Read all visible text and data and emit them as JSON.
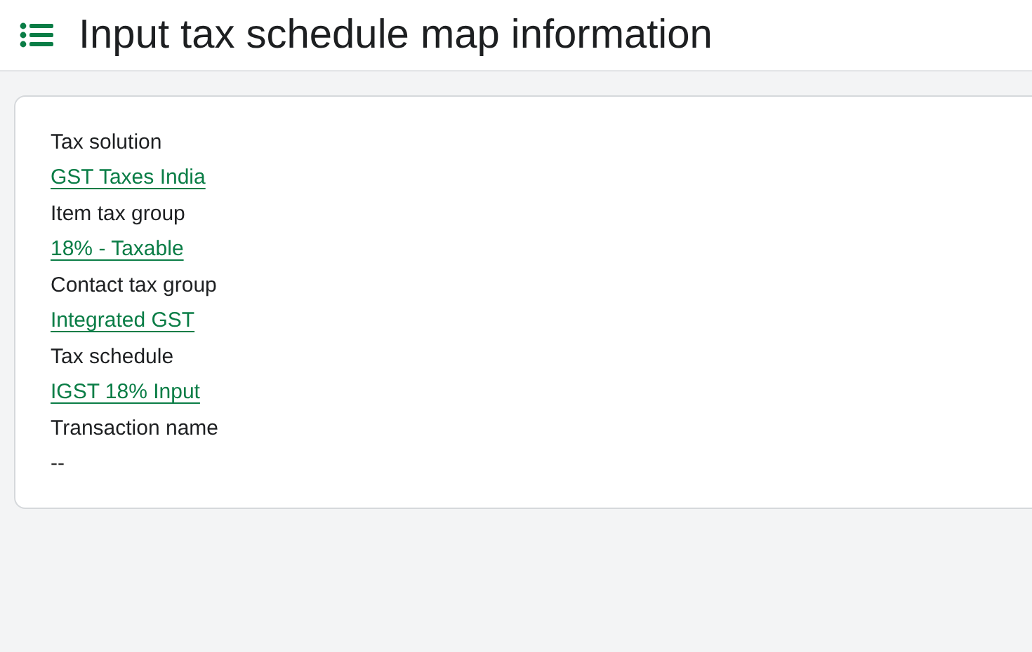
{
  "header": {
    "title": "Input tax schedule map information"
  },
  "fields": [
    {
      "label": "Tax solution",
      "value": "GST Taxes India",
      "kind": "link"
    },
    {
      "label": "Item tax group",
      "value": "18% - Taxable",
      "kind": "link"
    },
    {
      "label": "Contact tax group",
      "value": "Integrated GST",
      "kind": "link"
    },
    {
      "label": "Tax schedule",
      "value": "IGST 18% Input",
      "kind": "link"
    },
    {
      "label": "Transaction name",
      "value": "--",
      "kind": "text"
    }
  ]
}
